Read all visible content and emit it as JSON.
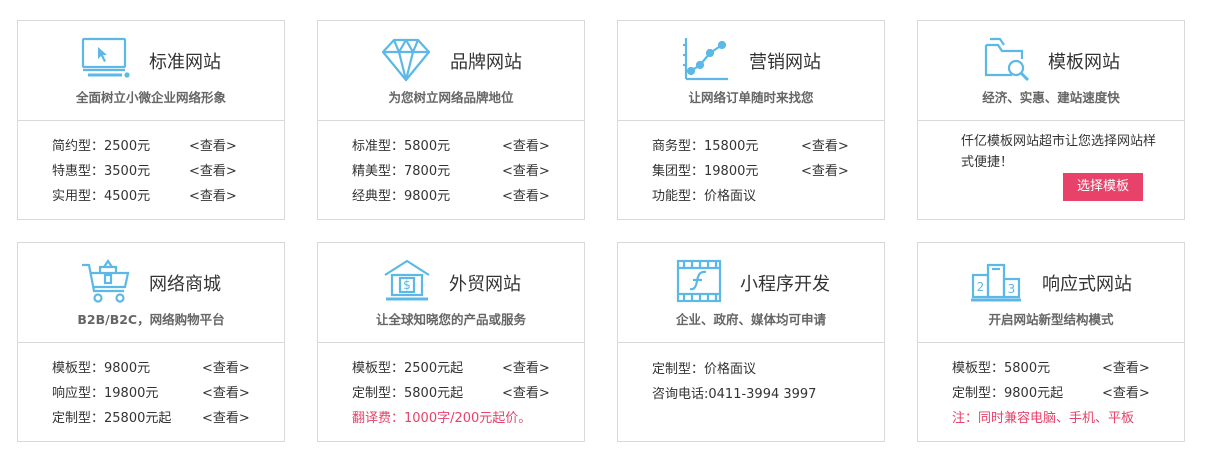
{
  "colors": {
    "accent": "#5cb8e6",
    "red": "#e8426a",
    "border": "#d9d9d9"
  },
  "cards": [
    {
      "icon": "computer-icon",
      "title": "标准网站",
      "subtitle": "全面树立小微企业网络形象",
      "rows": [
        {
          "label": "简约型：2500元",
          "link": "<查看>"
        },
        {
          "label": "特惠型：3500元",
          "link": "<查看>"
        },
        {
          "label": "实用型：4500元",
          "link": "<查看>"
        }
      ]
    },
    {
      "icon": "diamond-icon",
      "title": "品牌网站",
      "subtitle": "为您树立网络品牌地位",
      "rows": [
        {
          "label": "标准型：5800元",
          "link": "<查看>"
        },
        {
          "label": "精美型：7800元",
          "link": "<查看>"
        },
        {
          "label": "经典型：9800元",
          "link": "<查看>"
        }
      ]
    },
    {
      "icon": "line-chart-icon",
      "title": "营销网站",
      "subtitle": "让网络订单随时来找您",
      "rows": [
        {
          "label": "商务型：15800元",
          "link": "<查看>"
        },
        {
          "label": "集团型：19800元",
          "link": "<查看>"
        },
        {
          "label": "功能型：价格面议"
        }
      ]
    },
    {
      "icon": "folder-search-icon",
      "title": "模板网站",
      "subtitle": "经济、实惠、建站速度快",
      "promo": "仟亿模板网站超市让您选择网站样式便捷！",
      "button": "选择模板"
    },
    {
      "icon": "shopping-cart-icon",
      "title": "网络商城",
      "subtitle": "B2B/B2C，网络购物平台",
      "rows": [
        {
          "label": "模板型：9800元",
          "link": "<查看>"
        },
        {
          "label": "响应型：19800元",
          "link": "<查看>"
        },
        {
          "label": "定制型：25800元起",
          "link": "<查看>"
        }
      ]
    },
    {
      "icon": "bank-dollar-icon",
      "title": "外贸网站",
      "subtitle": "让全球知晓您的产品或服务",
      "rows": [
        {
          "label": "模板型：2500元起",
          "link": "<查看>"
        },
        {
          "label": "定制型：5800元起",
          "link": "<查看>"
        }
      ],
      "note": "翻译费：1000字/200元起价。"
    },
    {
      "icon": "flash-film-icon",
      "title": "小程序开发",
      "subtitle": "企业、政府、媒体均可申请",
      "lines": [
        "定制型：价格面议",
        "咨询电话:0411-3994 3997"
      ]
    },
    {
      "icon": "podium-icon",
      "title": "响应式网站",
      "subtitle": "开启网站新型结构模式",
      "rows": [
        {
          "label": "模板型：5800元",
          "link": "<查看>"
        },
        {
          "label": "定制型：9800元起",
          "link": "<查看>"
        }
      ],
      "note": "注：同时兼容电脑、手机、平板"
    }
  ]
}
